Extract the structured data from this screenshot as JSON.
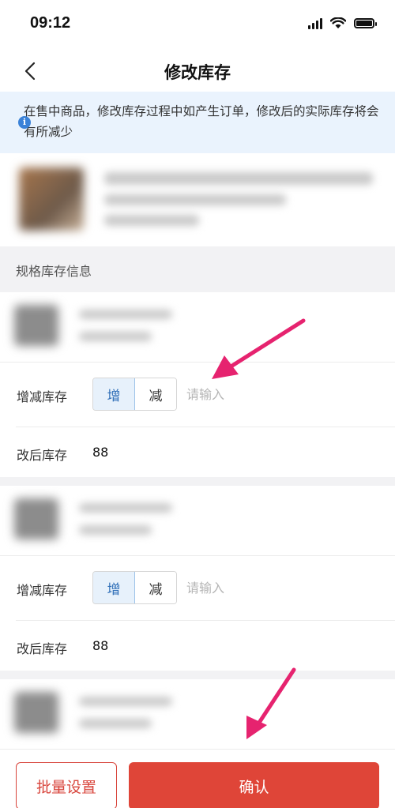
{
  "status": {
    "time": "09:12"
  },
  "nav": {
    "title": "修改库存"
  },
  "notice": {
    "text": "在售中商品，修改库存过程中如产生订单，修改后的实际库存将会有所减少"
  },
  "section": {
    "title": "规格库存信息"
  },
  "skus": [
    {
      "adjust_label": "增减库存",
      "increase_label": "增",
      "decrease_label": "减",
      "mode": "增",
      "input_placeholder": "请输入",
      "input_value": "",
      "after_label": "改后库存",
      "after_value": "88"
    },
    {
      "adjust_label": "增减库存",
      "increase_label": "增",
      "decrease_label": "减",
      "mode": "增",
      "input_placeholder": "请输入",
      "input_value": "",
      "after_label": "改后库存",
      "after_value": "88"
    }
  ],
  "footer": {
    "batch_label": "批量设置",
    "confirm_label": "确认"
  },
  "colors": {
    "accent_red": "#df4538",
    "notice_bg": "#eaf3fd",
    "toggle_active": "#2f6fb8",
    "arrow_pink": "#e6236f"
  },
  "icons": {
    "back": "chevron-left-icon",
    "info": "info-icon",
    "signal": "signal-icon",
    "wifi": "wifi-icon",
    "battery": "battery-icon"
  }
}
